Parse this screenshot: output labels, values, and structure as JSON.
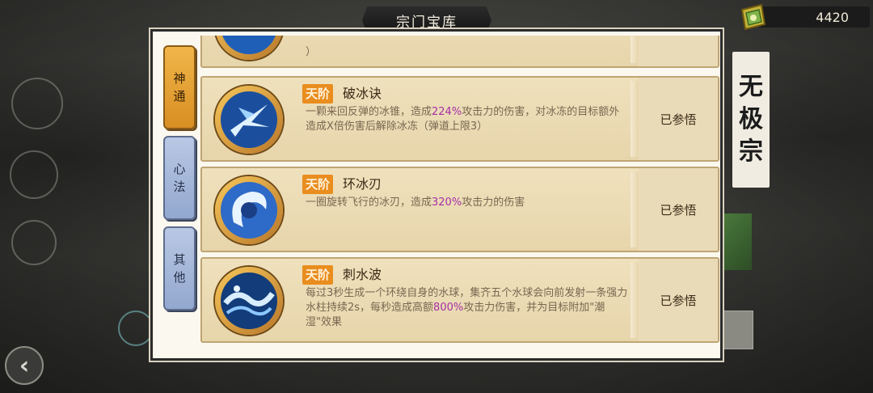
{
  "header": {
    "title": "宗门宝库"
  },
  "currency": {
    "amount": "4420",
    "icon": "jade-token-icon"
  },
  "sect": {
    "name_chars": [
      "无",
      "极",
      "宗"
    ]
  },
  "tabs": [
    {
      "label_chars": [
        "神",
        "通"
      ],
      "active": true
    },
    {
      "label_chars": [
        "心",
        "法"
      ],
      "active": false
    },
    {
      "label_chars": [
        "其",
        "他"
      ],
      "active": false
    }
  ],
  "skills": [
    {
      "tier": "",
      "name": "",
      "desc_parts": [
        "）"
      ],
      "status": "",
      "icon": "ice-orb-icon"
    },
    {
      "tier": "天阶",
      "name": "破冰诀",
      "desc_parts": [
        "一颗来回反弹的冰锥，造成",
        "224%",
        "攻击力的伤害，对冰冻的目标额外造成X倍伤害后解除冰冻（弹道上限3）"
      ],
      "status": "已参悟",
      "icon": "ice-shard-icon"
    },
    {
      "tier": "天阶",
      "name": "环冰刃",
      "desc_parts": [
        "一圈旋转飞行的冰刃，造成",
        "320%",
        "攻击力的伤害"
      ],
      "status": "已参悟",
      "icon": "ice-ring-blade-icon"
    },
    {
      "tier": "天阶",
      "name": "刺水波",
      "desc_parts": [
        "每过3秒生成一个环绕自身的水球，集齐五个水球会向前发射一条强力水柱持续2s，每秒造成高额",
        "800%",
        "攻击力伤害，并为目标附加\"潮湿\"效果"
      ],
      "status": "已参悟",
      "icon": "water-wave-icon"
    }
  ],
  "colors": {
    "highlight": "#a52fa6",
    "tier_badge": "#e98d1e",
    "tab_active": "#e0a03a",
    "tab_inactive": "#a7b7da"
  }
}
